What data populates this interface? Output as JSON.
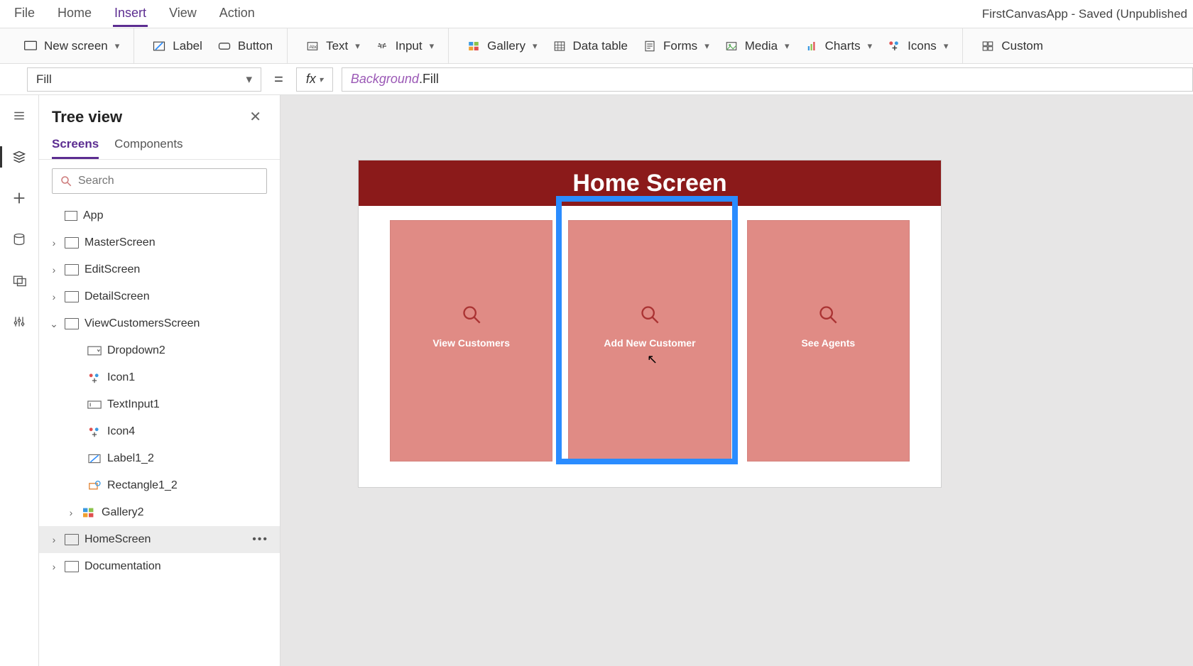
{
  "topmenu": {
    "file": "File",
    "home": "Home",
    "insert": "Insert",
    "view": "View",
    "action": "Action",
    "appTitle": "FirstCanvasApp - Saved (Unpublished"
  },
  "ribbon": {
    "newScreen": "New screen",
    "label": "Label",
    "button": "Button",
    "text": "Text",
    "input": "Input",
    "gallery": "Gallery",
    "dataTable": "Data table",
    "forms": "Forms",
    "media": "Media",
    "charts": "Charts",
    "icons": "Icons",
    "custom": "Custom"
  },
  "formulaBar": {
    "property": "Fill",
    "fxLabel": "fx",
    "token1": "Background",
    "token2": ".Fill"
  },
  "treePanel": {
    "title": "Tree view",
    "tabs": {
      "screens": "Screens",
      "components": "Components"
    },
    "searchPlaceholder": "Search",
    "app": "App",
    "items": {
      "master": "MasterScreen",
      "edit": "EditScreen",
      "detail": "DetailScreen",
      "viewCust": "ViewCustomersScreen",
      "dropdown2": "Dropdown2",
      "icon1": "Icon1",
      "textinput1": "TextInput1",
      "icon4": "Icon4",
      "label1_2": "Label1_2",
      "rect1_2": "Rectangle1_2",
      "gallery2": "Gallery2",
      "homescreen": "HomeScreen",
      "documentation": "Documentation"
    }
  },
  "canvas": {
    "headerTitle": "Home Screen",
    "cards": {
      "view": "View Customers",
      "add": "Add New Customer",
      "agents": "See Agents"
    }
  }
}
